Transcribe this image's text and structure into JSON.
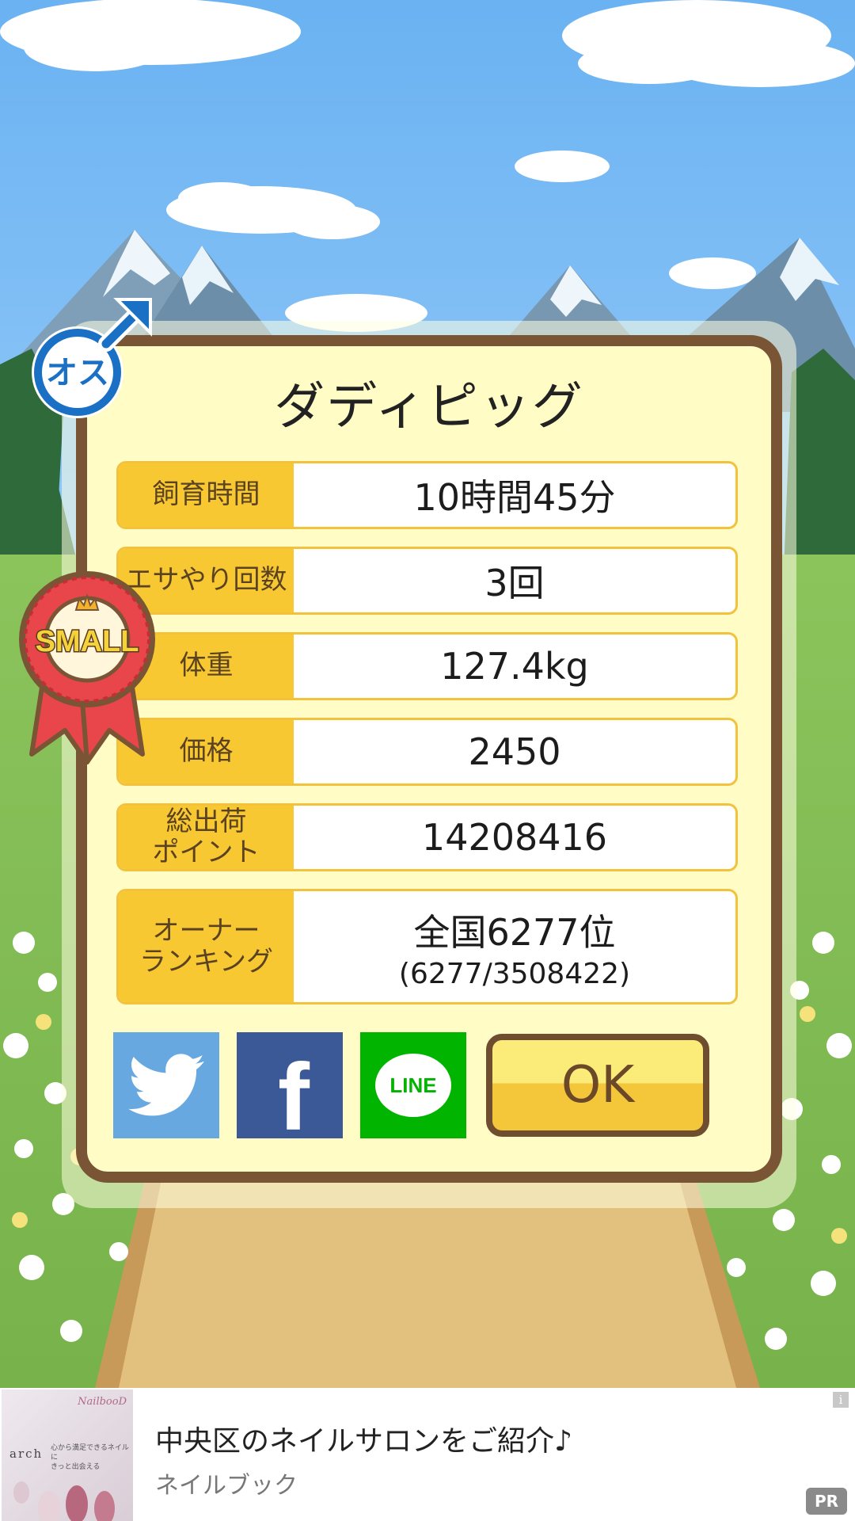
{
  "pig_name": "ダディピッグ",
  "gender_badge": {
    "label": "オス",
    "icon": "male-symbol-icon"
  },
  "size_ribbon": {
    "label": "SMALL",
    "icon": "crown-icon"
  },
  "stats": [
    {
      "label": "飼育時間",
      "value": "10時間45分"
    },
    {
      "label": "エサやり回数",
      "value": "3回"
    },
    {
      "label": "体重",
      "value": "127.4kg"
    },
    {
      "label": "価格",
      "value": "2450"
    },
    {
      "label": "総出荷\nポイント",
      "value": "14208416"
    },
    {
      "label": "オーナー\nランキング",
      "value": "全国6277位",
      "sub": "(6277/3508422)"
    }
  ],
  "share": [
    {
      "icon": "twitter-icon"
    },
    {
      "icon": "facebook-icon",
      "glyph": "f"
    },
    {
      "icon": "line-icon",
      "glyph": "LINE"
    }
  ],
  "ok_label": "OK",
  "ad": {
    "title": "中央区のネイルサロンをご紹介♪",
    "advertiser": "ネイルブック",
    "pr_label": "PR",
    "info_label": "i",
    "thumb_brand": "arch",
    "thumb_copy": "心から満足できるネイルに\nきっと出会える",
    "thumb_script": "NailbooD"
  },
  "colors": {
    "card_bg": "#fffcc5",
    "card_border": "#7a5535",
    "label_bg": "#f8c832",
    "ok_top": "#fbec7a",
    "ok_bottom": "#f4c63a",
    "twitter": "#68a8e0",
    "facebook": "#3b5897",
    "line": "#00b400"
  }
}
